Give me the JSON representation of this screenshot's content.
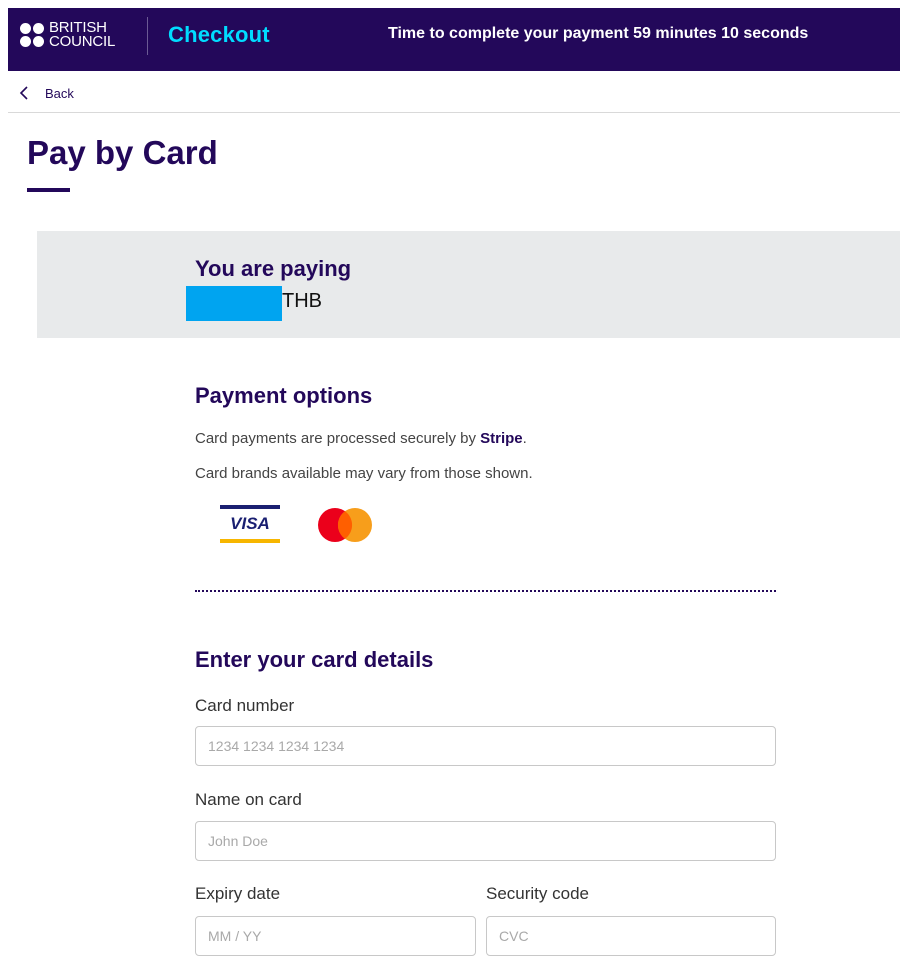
{
  "header": {
    "logo_line1": "BRITISH",
    "logo_line2": "COUNCIL",
    "title": "Checkout",
    "timer": "Time to complete your payment 59 minutes 10 seconds"
  },
  "nav": {
    "back_label": "Back"
  },
  "page_title": "Pay by Card",
  "paying": {
    "label": "You are paying",
    "currency": "THB"
  },
  "payment_options": {
    "heading": "Payment options",
    "line1_prefix": "Card payments are processed securely by ",
    "line1_brand": "Stripe",
    "line1_suffix": ".",
    "line2": "Card brands available may vary from those shown.",
    "brands": [
      "visa-logo",
      "mastercard-logo"
    ],
    "visa_text": "VISA"
  },
  "card_details": {
    "heading": "Enter your card details",
    "card_number": {
      "label": "Card number",
      "placeholder": "1234 1234 1234 1234",
      "value": ""
    },
    "name_on_card": {
      "label": "Name on card",
      "placeholder": "John Doe",
      "value": ""
    },
    "expiry": {
      "label": "Expiry date",
      "placeholder": "MM / YY",
      "value": ""
    },
    "security": {
      "label": "Security code",
      "placeholder": "CVC",
      "value": ""
    }
  },
  "colors": {
    "brand_purple": "#23085a",
    "accent_cyan": "#00dcff",
    "panel_grey": "#e8eaeb",
    "redaction_blue": "#00a4f0"
  }
}
